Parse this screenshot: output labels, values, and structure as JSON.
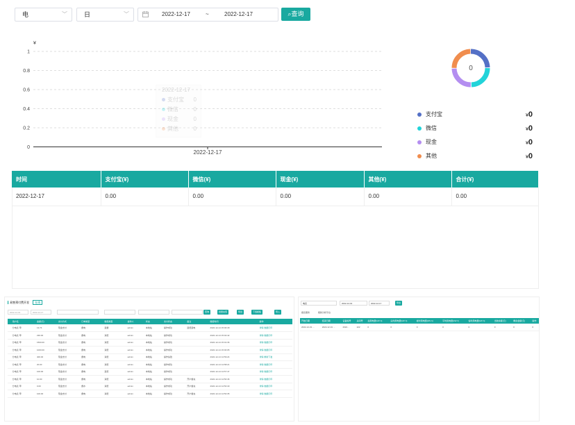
{
  "filters": {
    "type_value": "电",
    "period_value": "日",
    "date_start": "2022-12-17",
    "date_sep": "~",
    "date_end": "2022-12-17",
    "query_label": "查询"
  },
  "chart_data": {
    "type": "bar",
    "ylabel": "¥",
    "yticks": [
      "1",
      "0.8",
      "0.6",
      "0.4",
      "0.2",
      "0"
    ],
    "ylim": [
      0,
      1
    ],
    "categories": [
      "2022-12-17"
    ],
    "series": [
      {
        "name": "支付宝",
        "values": [
          0
        ]
      },
      {
        "name": "微信",
        "values": [
          0
        ]
      },
      {
        "name": "现金",
        "values": [
          0
        ]
      },
      {
        "name": "其他",
        "values": [
          0
        ]
      }
    ],
    "grid": true
  },
  "tooltip": {
    "date": "2022-12-17",
    "items": [
      {
        "label": "支付宝",
        "value": "0"
      },
      {
        "label": "微信",
        "value": "0"
      },
      {
        "label": "现金",
        "value": "0"
      },
      {
        "label": "其他",
        "value": "0"
      }
    ]
  },
  "donut": {
    "center": "0",
    "colors": [
      "#5470c6",
      "#22d3d9",
      "#b48ef0",
      "#f08d4e"
    ]
  },
  "legend": [
    {
      "label": "支付宝",
      "currency": "¥",
      "value": "0",
      "color": "#5470c6"
    },
    {
      "label": "微信",
      "currency": "¥",
      "value": "0",
      "color": "#22d3d9"
    },
    {
      "label": "现金",
      "currency": "¥",
      "value": "0",
      "color": "#b48ef0"
    },
    {
      "label": "其他",
      "currency": "¥",
      "value": "0",
      "color": "#f08d4e"
    }
  ],
  "table": {
    "headers": [
      "时间",
      "支付宝(¥)",
      "微信(¥)",
      "现金(¥)",
      "其他(¥)",
      "合计(¥)"
    ],
    "rows": [
      [
        "2022-12-17",
        "0.00",
        "0.00",
        "0.00",
        "0.00",
        "0.00"
      ]
    ]
  },
  "thumb_left": {
    "title": "易售预付费开发",
    "tag": "在线",
    "date_start": "2022-12-01",
    "date_end": "2022-12-17",
    "buttons": [
      "查询",
      "批量充值",
      "导出",
      "下载模板",
      "导入"
    ],
    "headers": [
      "",
      "用户名",
      "金额(元)",
      "支付方式",
      "订单类型",
      "缴费类型",
      "操作人",
      "状态",
      "支付状态",
      "备注",
      "缴费时间",
      "操作"
    ],
    "rows": [
      [
        "",
        "分电表 甲",
        "13.74",
        "现金支付",
        "費电",
        "退費",
        "admin",
        "本地站",
        "操作成功",
        "退费退电",
        "2022-12-14 15:00:18",
        "详情 收据打印"
      ],
      [
        "",
        "分电表 甲",
        "230.00",
        "现金支付",
        "費电",
        "消费",
        "admin",
        "本地站",
        "操作成功",
        "",
        "2022-12-14 15:02:42",
        "详情 收据打印"
      ],
      [
        "",
        "分电表 甲",
        "1500.00",
        "现金支付",
        "費电",
        "消费",
        "admin",
        "本地站",
        "操作成功",
        "",
        "2022-12-14 15:01:36",
        "详情 收据打印"
      ],
      [
        "",
        "分电表 甲",
        "1000.00",
        "现金支付",
        "費电",
        "消费",
        "admin",
        "本地站",
        "操作成功",
        "",
        "2022-12-14 15:00:05",
        "详情 收据打印"
      ],
      [
        "",
        "分电表 甲",
        "400.00",
        "现金支付",
        "費电",
        "消费",
        "admin",
        "本地站",
        "操作失败",
        "",
        "2022-12-14 14:59:24",
        "详情 重新下发"
      ],
      [
        "",
        "分电表 甲",
        "20.00",
        "现金支付",
        "費电",
        "消费",
        "admin",
        "本地站",
        "操作成功",
        "",
        "2022-12-14 14:58:21",
        "详情 收据打印"
      ],
      [
        "",
        "分电表 甲",
        "100.00",
        "现金支付",
        "費电",
        "退费",
        "admin",
        "本地站",
        "操作成功",
        "",
        "2022-12-14 14:57:47",
        "详情 收据打印"
      ],
      [
        "",
        "分电表 甲",
        "10.00",
        "现金支付",
        "費电",
        "消费",
        "admin",
        "本地站",
        "操作成功",
        "开户餐充",
        "2022-12-14 14:50:46",
        "详情 收据打印"
      ],
      [
        "",
        "分电表 甲",
        "0.00",
        "现金支付",
        "費水",
        "消费",
        "admin",
        "本地站",
        "操作成功",
        "开户餐充",
        "2022-12-14 14:50:40",
        "详情 收据打印"
      ],
      [
        "",
        "分电表 甲",
        "100.00",
        "现金支付",
        "費电",
        "消费",
        "admin",
        "本地站",
        "操作成功",
        "开户餐充",
        "2022-12-14 14:50:35",
        "详情 收据打印"
      ]
    ]
  },
  "thumb_right": {
    "select_value": "电表",
    "date_start": "2022-12-01",
    "date_end": "2022-12-17",
    "export_label": "导出",
    "tabs": [
      "报表服务",
      "能耗分析平台"
    ],
    "headers": [
      "开始日期",
      "结束日期",
      "设备编号",
      "房间号",
      "总用电量(kW·h)",
      "尖时用电量(kW·h)",
      "峰时用电量(kW·h)",
      "平时用电量(kW·h)",
      "谷时用电量(kW·h)",
      "当前余额(元)",
      "剩余金额(元)",
      "操作"
    ],
    "rows": [
      [
        "2022-12-01 ...",
        "2022-12-01 ...",
        "2022...",
        "222",
        "0",
        "0",
        "0",
        "0",
        "0",
        "0",
        "0",
        "0"
      ]
    ]
  }
}
